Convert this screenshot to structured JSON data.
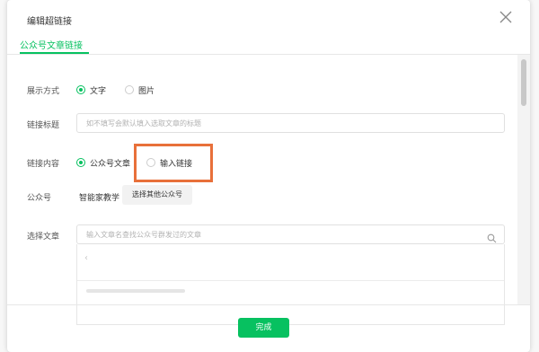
{
  "dialog": {
    "title": "编辑超链接",
    "close_icon": "close-icon"
  },
  "tabs": [
    {
      "label": "公众号文章链接",
      "active": true
    }
  ],
  "form": {
    "display_mode": {
      "label": "展示方式",
      "options": [
        "文字",
        "图片"
      ],
      "selected": "文字"
    },
    "link_title": {
      "label": "链接标题",
      "value": "",
      "placeholder": "如不填写会默认填入选取文章的标题"
    },
    "link_content": {
      "label": "链接内容",
      "options": [
        "公众号文章",
        "输入链接"
      ],
      "selected": "公众号文章"
    },
    "account": {
      "label": "公众号",
      "name": "智能家教学",
      "select_button": "选择其他公众号"
    },
    "select_article": {
      "label": "选择文章",
      "value": "",
      "placeholder": "输入文章名查找公众号群发过的文章",
      "icon": "search-icon"
    },
    "results_back": "‹"
  },
  "footer": {
    "done_label": "完成"
  },
  "colors": {
    "accent": "#07c160",
    "highlight": "#e8703a"
  }
}
